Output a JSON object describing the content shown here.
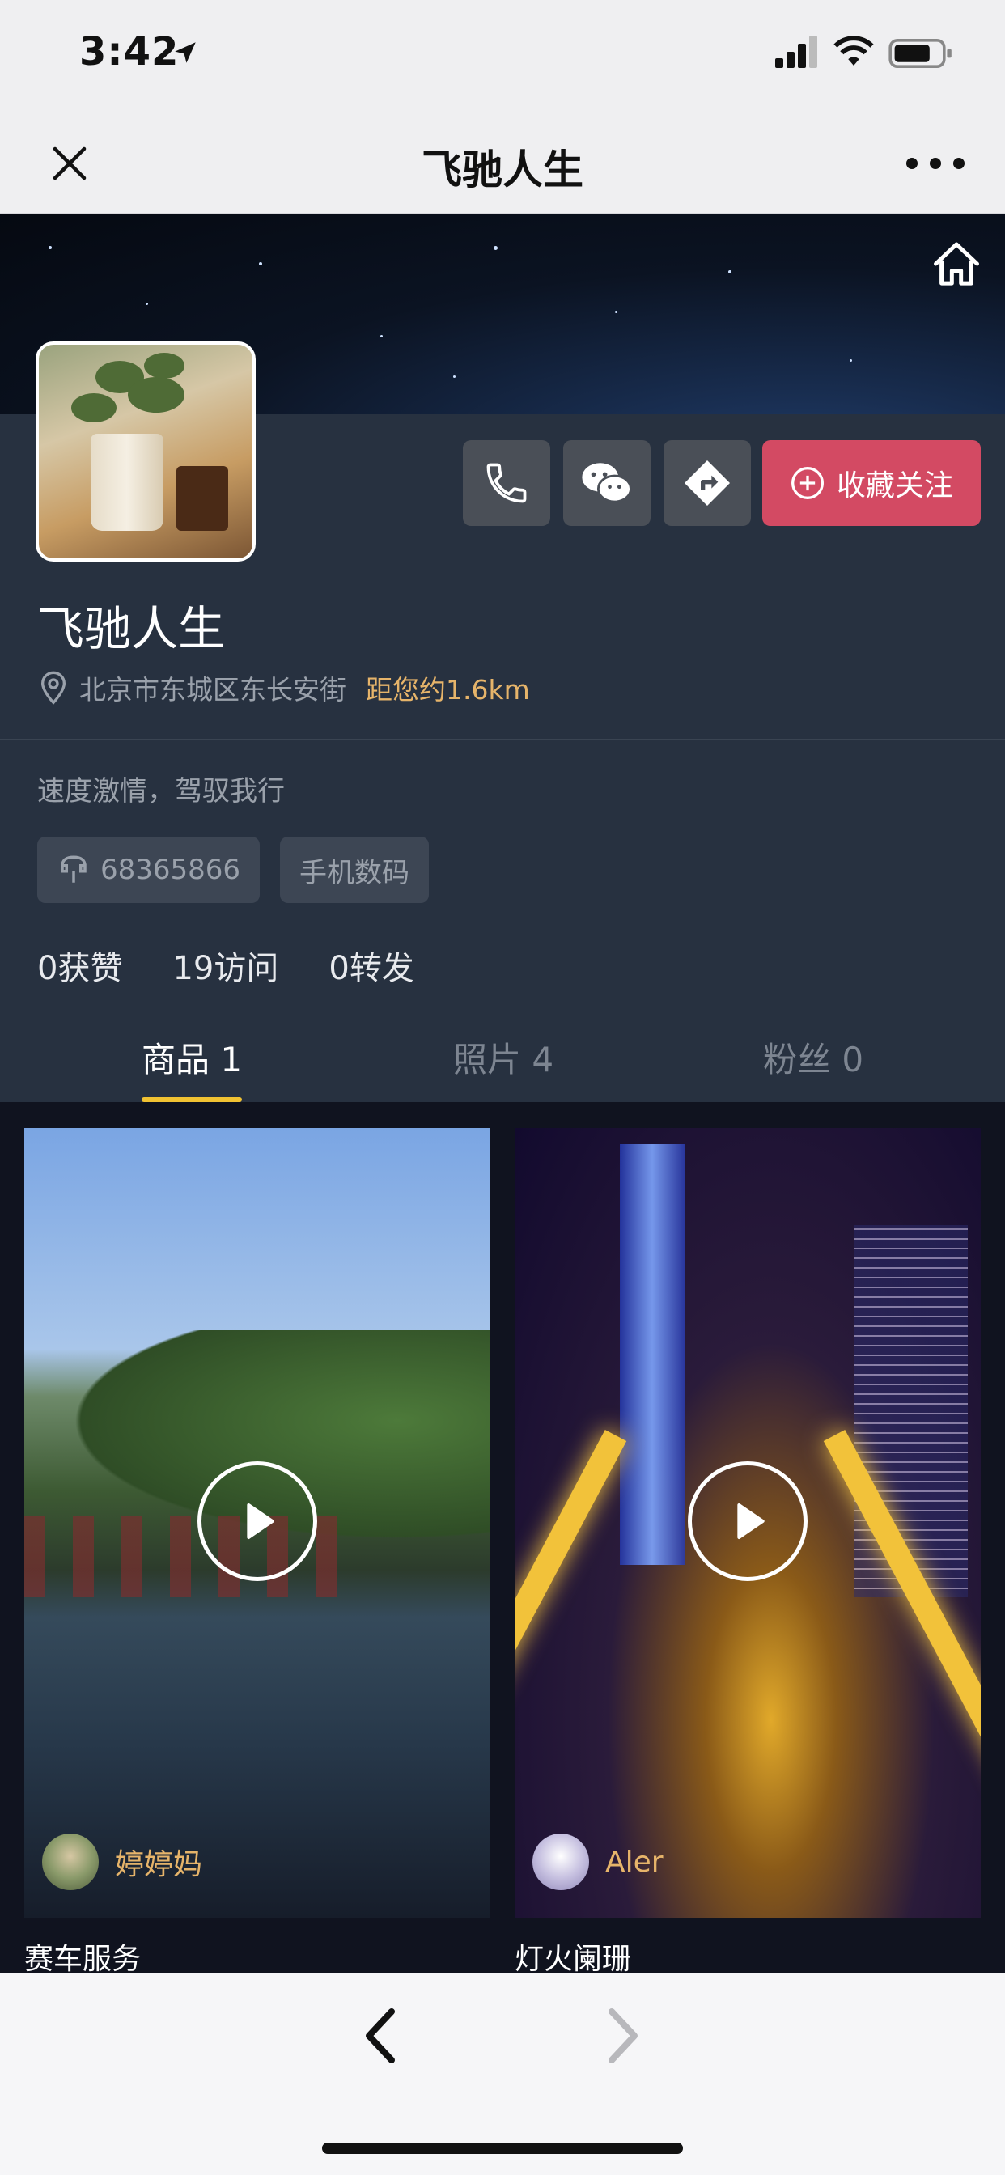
{
  "status_bar": {
    "time": "3:42"
  },
  "nav": {
    "title": "飞驰人生"
  },
  "profile": {
    "name": "飞驰人生",
    "address": "北京市东城区东长安街",
    "distance": "距您约1.6km",
    "follow_label": "收藏关注",
    "slogan": "速度激情，驾驭我行",
    "phone_tag": "68365866",
    "category_tag": "手机数码",
    "stats": [
      {
        "count": "0",
        "label": "获赞"
      },
      {
        "count": "19",
        "label": "访问"
      },
      {
        "count": "0",
        "label": "转发"
      }
    ]
  },
  "tabs": [
    {
      "label": "商品",
      "count": "1",
      "active": true
    },
    {
      "label": "照片",
      "count": "4",
      "active": false
    },
    {
      "label": "粉丝",
      "count": "0",
      "active": false
    }
  ],
  "cards": [
    {
      "user": "婷婷妈",
      "title": "赛车服务"
    },
    {
      "user": "Aler",
      "title": "灯火阑珊"
    }
  ],
  "colors": {
    "accent_follow": "#d34a63",
    "distance_text": "#e6b46a",
    "tab_underline": "#f1c232",
    "panel_bg": "#273140"
  },
  "icons": [
    "close-icon",
    "more-icon",
    "home-icon",
    "phone-icon",
    "wechat-icon",
    "directions-icon",
    "add-circle-icon",
    "location-pin-icon",
    "phone-tag-icon",
    "play-icon",
    "back-chevron-icon",
    "forward-chevron-icon"
  ]
}
